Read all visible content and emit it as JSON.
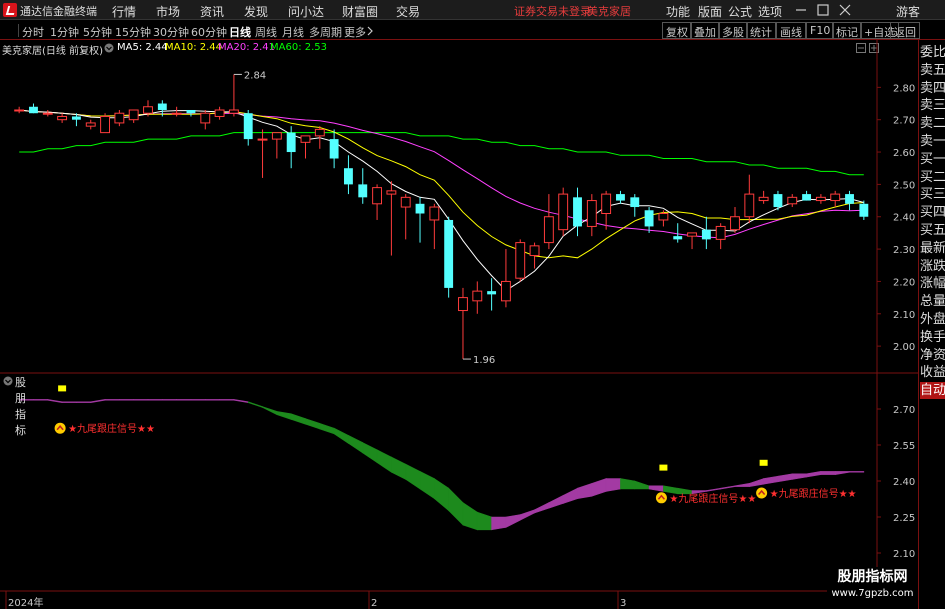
{
  "window": {
    "title": "通达信金融终端"
  },
  "menu": [
    "行情",
    "市场",
    "资讯",
    "发现",
    "问小达",
    "财富圈",
    "交易"
  ],
  "status": {
    "warning": "证券交易未登录",
    "stock_name_top": "美克家居"
  },
  "menu_right": [
    "功能",
    "版面",
    "公式",
    "选项"
  ],
  "user": "游客",
  "periods": [
    "分时",
    "1分钟",
    "5分钟",
    "15分钟",
    "30分钟",
    "60分钟",
    "日线",
    "周线",
    "月线",
    "多周期",
    "更多"
  ],
  "active_period": "日线",
  "tool_buttons": [
    "复权",
    "叠加",
    "多股",
    "统计",
    "画线",
    "F10",
    "标记",
    "+自选",
    "返回"
  ],
  "info": {
    "stock": "美克家居(日线 前复权)",
    "ma": [
      {
        "label": "MA5: 2.44",
        "color": "#ffffff"
      },
      {
        "label": "MA10: 2.44",
        "color": "#ffff00"
      },
      {
        "label": "MA20: 2.41",
        "color": "#ff40ff"
      },
      {
        "label": "MA60: 2.53",
        "color": "#00ff00"
      }
    ]
  },
  "annotations": {
    "high": "2.84",
    "low": "1.96"
  },
  "price_axis": [
    "2.80",
    "2.70",
    "2.60",
    "2.50",
    "2.40",
    "2.30",
    "2.20",
    "2.10",
    "2.00"
  ],
  "indicator": {
    "name": "股朋指标",
    "axis": [
      "2.70",
      "2.55",
      "2.40",
      "2.25",
      "2.10"
    ],
    "signal_label": "★九尾跟庄信号★★"
  },
  "date_axis": [
    "2024年",
    "2",
    "3"
  ],
  "right_panel": [
    "委比",
    "卖五",
    "卖四",
    "卖三",
    "卖二",
    "卖一",
    "买一",
    "买二",
    "买三",
    "买四",
    "买五",
    "最新",
    "涨跌",
    "涨幅",
    "总量",
    "外盘",
    "换手",
    "净资",
    "收益",
    "自动"
  ],
  "right_panel_active": "自动",
  "watermark": {
    "title": "股朋指标网",
    "url": "www.7gpzb.com"
  },
  "colors": {
    "up": "#ff3c3c",
    "down": "#54ffff",
    "ma5": "#ffffff",
    "ma10": "#ffff00",
    "ma20": "#ff40ff",
    "ma60": "#00ff00",
    "ind_up": "#a33aa3",
    "ind_down": "#1d8a1d"
  },
  "chart_data": {
    "type": "candlestick",
    "ylim": [
      1.92,
      2.9
    ],
    "candles": [
      {
        "o": 2.73,
        "h": 2.74,
        "l": 2.72,
        "c": 2.73
      },
      {
        "o": 2.74,
        "h": 2.75,
        "l": 2.72,
        "c": 2.72
      },
      {
        "o": 2.72,
        "h": 2.73,
        "l": 2.71,
        "c": 2.72
      },
      {
        "o": 2.7,
        "h": 2.72,
        "l": 2.69,
        "c": 2.71
      },
      {
        "o": 2.71,
        "h": 2.72,
        "l": 2.68,
        "c": 2.7
      },
      {
        "o": 2.68,
        "h": 2.7,
        "l": 2.67,
        "c": 2.69
      },
      {
        "o": 2.66,
        "h": 2.72,
        "l": 2.66,
        "c": 2.71
      },
      {
        "o": 2.69,
        "h": 2.73,
        "l": 2.68,
        "c": 2.72
      },
      {
        "o": 2.7,
        "h": 2.73,
        "l": 2.69,
        "c": 2.73
      },
      {
        "o": 2.72,
        "h": 2.76,
        "l": 2.71,
        "c": 2.74
      },
      {
        "o": 2.75,
        "h": 2.76,
        "l": 2.71,
        "c": 2.73
      },
      {
        "o": 2.72,
        "h": 2.74,
        "l": 2.71,
        "c": 2.72
      },
      {
        "o": 2.73,
        "h": 2.73,
        "l": 2.71,
        "c": 2.72
      },
      {
        "o": 2.69,
        "h": 2.73,
        "l": 2.67,
        "c": 2.72
      },
      {
        "o": 2.71,
        "h": 2.74,
        "l": 2.7,
        "c": 2.73
      },
      {
        "o": 2.72,
        "h": 2.84,
        "l": 2.71,
        "c": 2.73
      },
      {
        "o": 2.72,
        "h": 2.73,
        "l": 2.62,
        "c": 2.64
      },
      {
        "o": 2.64,
        "h": 2.67,
        "l": 2.52,
        "c": 2.64
      },
      {
        "o": 2.64,
        "h": 2.66,
        "l": 2.58,
        "c": 2.66
      },
      {
        "o": 2.66,
        "h": 2.68,
        "l": 2.55,
        "c": 2.6
      },
      {
        "o": 2.63,
        "h": 2.65,
        "l": 2.58,
        "c": 2.65
      },
      {
        "o": 2.65,
        "h": 2.68,
        "l": 2.61,
        "c": 2.67
      },
      {
        "o": 2.64,
        "h": 2.67,
        "l": 2.55,
        "c": 2.58
      },
      {
        "o": 2.55,
        "h": 2.59,
        "l": 2.47,
        "c": 2.5
      },
      {
        "o": 2.5,
        "h": 2.55,
        "l": 2.44,
        "c": 2.46
      },
      {
        "o": 2.44,
        "h": 2.5,
        "l": 2.39,
        "c": 2.49
      },
      {
        "o": 2.47,
        "h": 2.51,
        "l": 2.28,
        "c": 2.48
      },
      {
        "o": 2.43,
        "h": 2.47,
        "l": 2.33,
        "c": 2.46
      },
      {
        "o": 2.44,
        "h": 2.46,
        "l": 2.32,
        "c": 2.41
      },
      {
        "o": 2.39,
        "h": 2.44,
        "l": 2.3,
        "c": 2.43
      },
      {
        "o": 2.39,
        "h": 2.4,
        "l": 2.15,
        "c": 2.18
      },
      {
        "o": 2.11,
        "h": 2.18,
        "l": 1.96,
        "c": 2.15
      },
      {
        "o": 2.14,
        "h": 2.2,
        "l": 2.1,
        "c": 2.17
      },
      {
        "o": 2.17,
        "h": 2.21,
        "l": 2.11,
        "c": 2.16
      },
      {
        "o": 2.14,
        "h": 2.3,
        "l": 2.12,
        "c": 2.2
      },
      {
        "o": 2.21,
        "h": 2.33,
        "l": 2.2,
        "c": 2.32
      },
      {
        "o": 2.28,
        "h": 2.32,
        "l": 2.24,
        "c": 2.31
      },
      {
        "o": 2.32,
        "h": 2.47,
        "l": 2.3,
        "c": 2.4
      },
      {
        "o": 2.36,
        "h": 2.49,
        "l": 2.34,
        "c": 2.47
      },
      {
        "o": 2.46,
        "h": 2.49,
        "l": 2.34,
        "c": 2.37
      },
      {
        "o": 2.37,
        "h": 2.47,
        "l": 2.34,
        "c": 2.45
      },
      {
        "o": 2.41,
        "h": 2.48,
        "l": 2.36,
        "c": 2.47
      },
      {
        "o": 2.47,
        "h": 2.48,
        "l": 2.44,
        "c": 2.45
      },
      {
        "o": 2.46,
        "h": 2.47,
        "l": 2.4,
        "c": 2.43
      },
      {
        "o": 2.42,
        "h": 2.43,
        "l": 2.35,
        "c": 2.37
      },
      {
        "o": 2.39,
        "h": 2.42,
        "l": 2.37,
        "c": 2.41
      },
      {
        "o": 2.34,
        "h": 2.38,
        "l": 2.32,
        "c": 2.33
      },
      {
        "o": 2.34,
        "h": 2.35,
        "l": 2.3,
        "c": 2.35
      },
      {
        "o": 2.36,
        "h": 2.4,
        "l": 2.3,
        "c": 2.33
      },
      {
        "o": 2.33,
        "h": 2.38,
        "l": 2.3,
        "c": 2.37
      },
      {
        "o": 2.36,
        "h": 2.43,
        "l": 2.35,
        "c": 2.4
      },
      {
        "o": 2.4,
        "h": 2.53,
        "l": 2.38,
        "c": 2.47
      },
      {
        "o": 2.45,
        "h": 2.48,
        "l": 2.44,
        "c": 2.46
      },
      {
        "o": 2.47,
        "h": 2.48,
        "l": 2.42,
        "c": 2.43
      },
      {
        "o": 2.44,
        "h": 2.47,
        "l": 2.43,
        "c": 2.46
      },
      {
        "o": 2.47,
        "h": 2.48,
        "l": 2.45,
        "c": 2.45
      },
      {
        "o": 2.45,
        "h": 2.47,
        "l": 2.44,
        "c": 2.46
      },
      {
        "o": 2.45,
        "h": 2.48,
        "l": 2.43,
        "c": 2.47
      },
      {
        "o": 2.47,
        "h": 2.48,
        "l": 2.42,
        "c": 2.44
      },
      {
        "o": 2.44,
        "h": 2.45,
        "l": 2.39,
        "c": 2.4
      }
    ],
    "ma60": [
      2.6,
      2.6,
      2.61,
      2.61,
      2.62,
      2.62,
      2.63,
      2.63,
      2.63,
      2.64,
      2.64,
      2.64,
      2.65,
      2.65,
      2.65,
      2.66,
      2.66,
      2.66,
      2.66,
      2.66,
      2.66,
      2.66,
      2.66,
      2.66,
      2.66,
      2.66,
      2.66,
      2.66,
      2.65,
      2.65,
      2.65,
      2.64,
      2.64,
      2.63,
      2.63,
      2.62,
      2.62,
      2.61,
      2.61,
      2.6,
      2.6,
      2.6,
      2.59,
      2.59,
      2.59,
      2.58,
      2.58,
      2.58,
      2.57,
      2.57,
      2.57,
      2.56,
      2.56,
      2.55,
      2.55,
      2.55,
      2.54,
      2.54,
      2.53,
      2.53
    ]
  },
  "indicator_data": {
    "ylim": [
      2.05,
      2.8
    ],
    "upper": [
      2.74,
      2.74,
      2.74,
      2.73,
      2.73,
      2.73,
      2.74,
      2.74,
      2.74,
      2.74,
      2.74,
      2.74,
      2.74,
      2.74,
      2.74,
      2.74,
      2.73,
      2.71,
      2.69,
      2.68,
      2.66,
      2.64,
      2.62,
      2.59,
      2.56,
      2.53,
      2.5,
      2.47,
      2.44,
      2.41,
      2.37,
      2.31,
      2.27,
      2.25,
      2.25,
      2.26,
      2.28,
      2.31,
      2.34,
      2.37,
      2.39,
      2.41,
      2.41,
      2.4,
      2.38,
      2.38,
      2.37,
      2.36,
      2.36,
      2.37,
      2.38,
      2.39,
      2.41,
      2.42,
      2.43,
      2.43,
      2.44,
      2.44,
      2.44,
      2.44
    ],
    "lower": [
      2.74,
      2.74,
      2.74,
      2.73,
      2.73,
      2.73,
      2.74,
      2.74,
      2.74,
      2.74,
      2.74,
      2.74,
      2.74,
      2.74,
      2.74,
      2.74,
      2.73,
      2.71,
      2.68,
      2.66,
      2.64,
      2.62,
      2.6,
      2.56,
      2.52,
      2.48,
      2.44,
      2.41,
      2.37,
      2.33,
      2.28,
      2.22,
      2.2,
      2.2,
      2.21,
      2.24,
      2.27,
      2.29,
      2.31,
      2.33,
      2.34,
      2.36,
      2.37,
      2.37,
      2.37,
      2.36,
      2.35,
      2.35,
      2.36,
      2.37,
      2.38,
      2.38,
      2.39,
      2.4,
      2.41,
      2.42,
      2.43,
      2.43,
      2.44,
      2.44
    ]
  }
}
